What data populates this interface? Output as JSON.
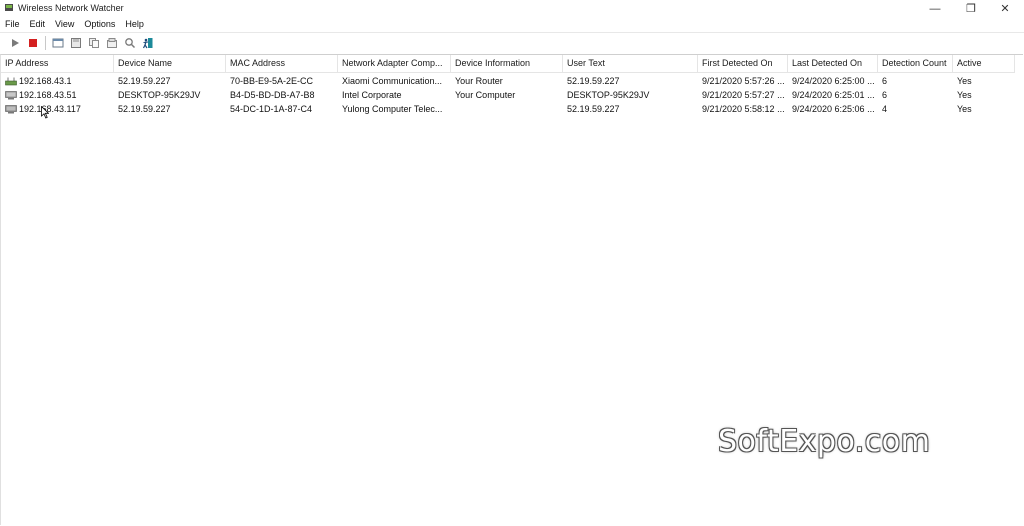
{
  "window": {
    "title": "Wireless Network Watcher",
    "controls": {
      "minimize": "—",
      "maximize": "❐",
      "close": "✕"
    }
  },
  "menu": {
    "items": [
      {
        "label": "File"
      },
      {
        "label": "Edit"
      },
      {
        "label": "View"
      },
      {
        "label": "Options"
      },
      {
        "label": "Help"
      }
    ]
  },
  "toolbar": {
    "buttons": [
      "play-icon",
      "stop-icon",
      "html-report-icon",
      "save-icon",
      "copy-icon",
      "properties-icon",
      "find-icon",
      "exit-icon"
    ]
  },
  "table": {
    "columns": [
      {
        "label": "IP Address"
      },
      {
        "label": "Device Name"
      },
      {
        "label": "MAC Address"
      },
      {
        "label": "Network Adapter Comp..."
      },
      {
        "label": "Device Information"
      },
      {
        "label": "User Text"
      },
      {
        "label": "First Detected On"
      },
      {
        "label": "Last Detected On"
      },
      {
        "label": "Detection Count"
      },
      {
        "label": "Active"
      }
    ],
    "rows": [
      {
        "icon": "router-icon",
        "ip": "192.168.43.1",
        "device_name": "52.19.59.227",
        "mac": "70-BB-E9-5A-2E-CC",
        "adapter": "Xiaomi Communication...",
        "device_info": "Your Router",
        "user_text": "52.19.59.227",
        "first_detected": "9/21/2020 5:57:26 ...",
        "last_detected": "9/24/2020 6:25:00 ...",
        "count": "6",
        "active": "Yes"
      },
      {
        "icon": "computer-icon",
        "ip": "192.168.43.51",
        "device_name": "DESKTOP-95K29JV",
        "mac": "B4-D5-BD-DB-A7-B8",
        "adapter": "Intel Corporate",
        "device_info": "Your Computer",
        "user_text": "DESKTOP-95K29JV",
        "first_detected": "9/21/2020 5:57:27 ...",
        "last_detected": "9/24/2020 6:25:01 ...",
        "count": "6",
        "active": "Yes"
      },
      {
        "icon": "device-icon",
        "ip": "192.168.43.117",
        "device_name": "52.19.59.227",
        "mac": "54-DC-1D-1A-87-C4",
        "adapter": "Yulong Computer Telec...",
        "device_info": "",
        "user_text": "52.19.59.227",
        "first_detected": "9/21/2020 5:58:12 ...",
        "last_detected": "9/24/2020 6:25:06 ...",
        "count": "4",
        "active": "Yes"
      }
    ]
  },
  "watermark": "SoftExpo.com",
  "colors": {
    "stop_red": "#d42020",
    "play_gray": "#7a7a7a",
    "exit_teal": "#1c8a9a"
  }
}
